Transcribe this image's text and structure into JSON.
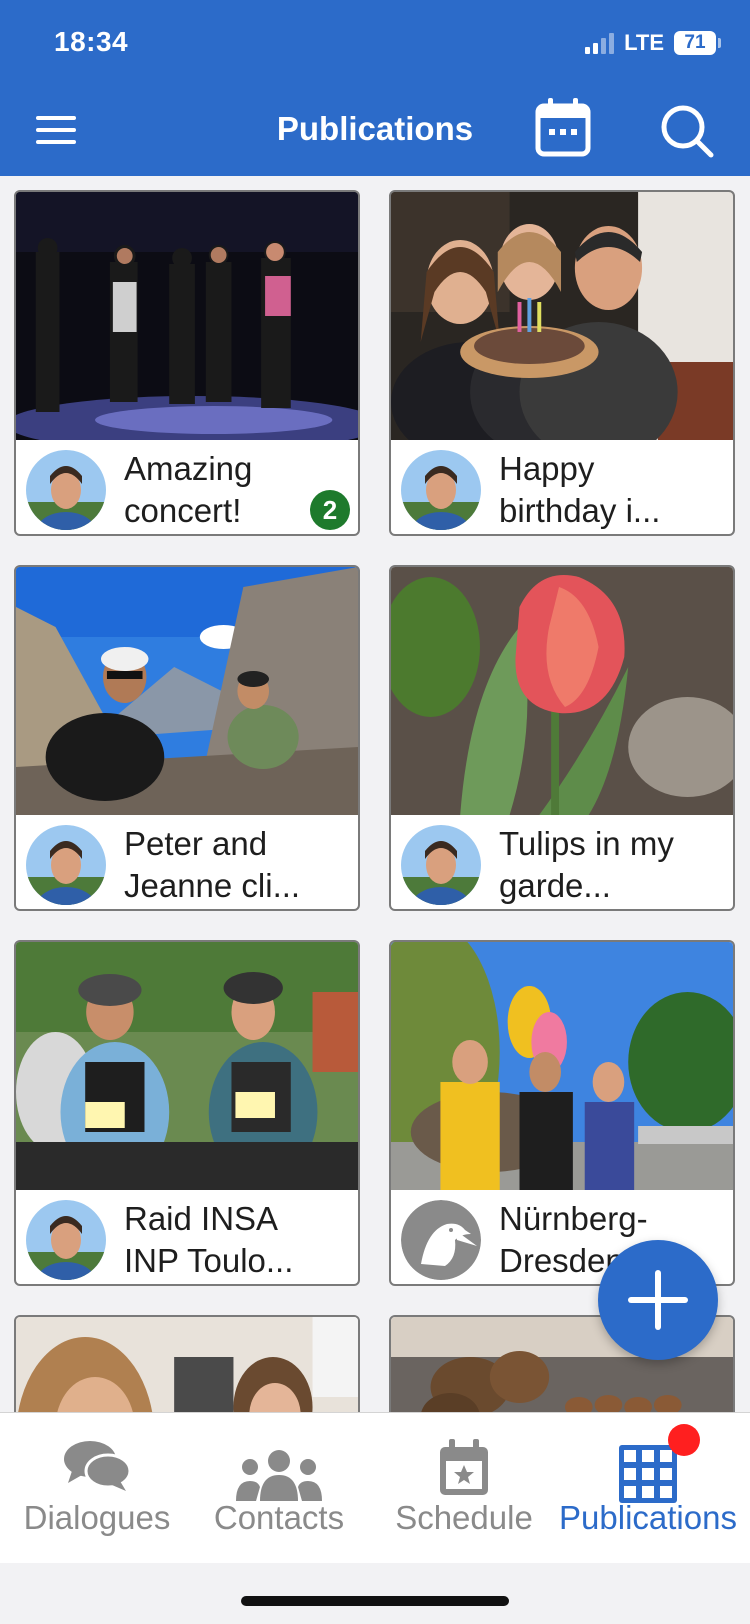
{
  "status_bar": {
    "time": "18:34",
    "network": "LTE",
    "battery": "71"
  },
  "header": {
    "title": "Publications"
  },
  "publications": [
    {
      "title": "Amazing concert!",
      "badge": "2",
      "author": "man-avatar"
    },
    {
      "title": "Happy birthday i...",
      "badge": "",
      "author": "man-avatar"
    },
    {
      "title": "Peter and Jeanne cli...",
      "badge": "",
      "author": "man-avatar"
    },
    {
      "title": "Tulips in my garde...",
      "badge": "",
      "author": "man-avatar"
    },
    {
      "title": "Raid INSA INP Toulo...",
      "badge": "",
      "author": "man-avatar"
    },
    {
      "title": "Nürnberg-Dresden",
      "badge": "",
      "author": "pelican-avatar"
    }
  ],
  "tabs": [
    {
      "label": "Dialogues",
      "icon": "chat-bubbles-icon"
    },
    {
      "label": "Contacts",
      "icon": "people-icon"
    },
    {
      "label": "Schedule",
      "icon": "calendar-star-icon"
    },
    {
      "label": "Publications",
      "icon": "grid-icon"
    }
  ],
  "colors": {
    "primary": "#2c6bc9",
    "badge": "#1e7a2c",
    "notification": "#ff1f1f"
  }
}
